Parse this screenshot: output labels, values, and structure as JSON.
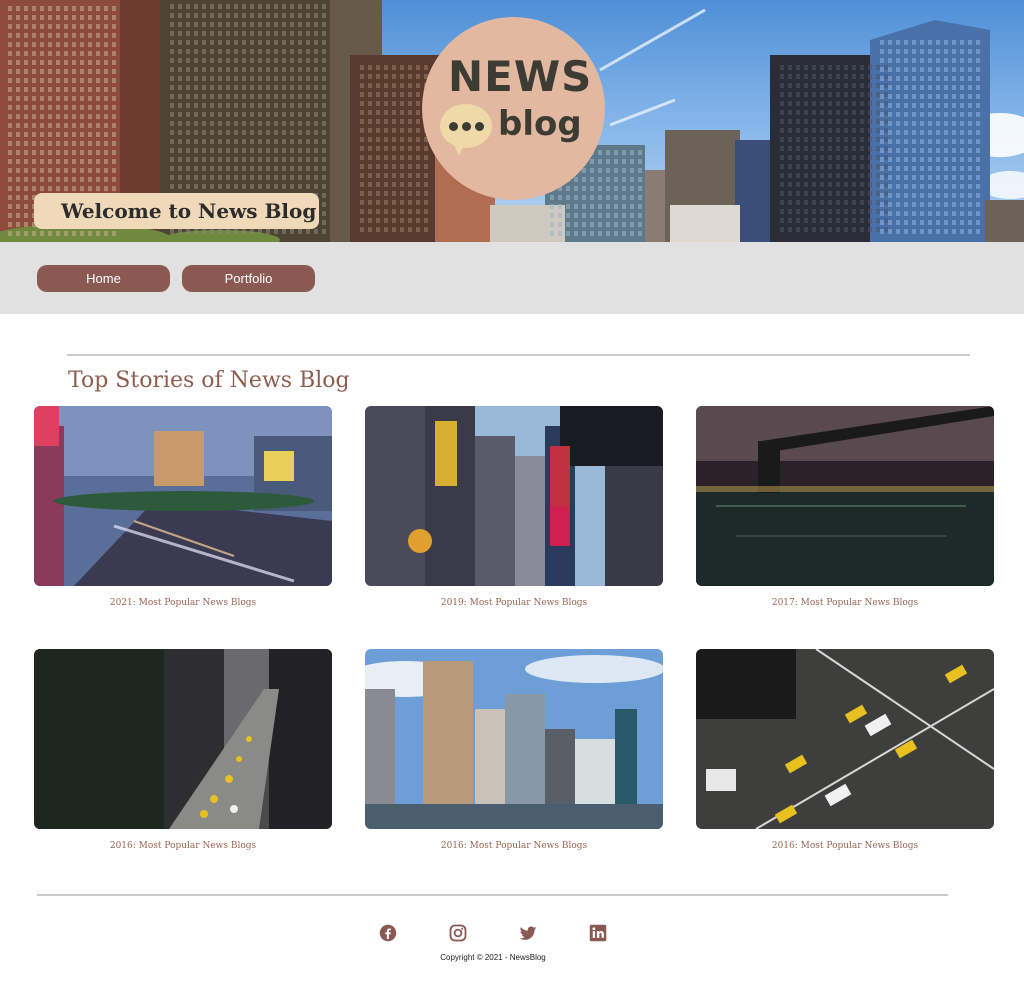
{
  "header": {
    "logo_top": "NEWS",
    "logo_bottom": "blog",
    "welcome": "Welcome to News Blog"
  },
  "nav": {
    "items": [
      {
        "label": "Home"
      },
      {
        "label": "Portfolio"
      }
    ]
  },
  "main": {
    "section_title": "Top Stories of News Blog",
    "stories": [
      {
        "caption": "2021: Most Popular News Blogs",
        "scene": "las-vegas-strip"
      },
      {
        "caption": "2019: Most Popular News Blogs",
        "scene": "times-square"
      },
      {
        "caption": "2017: Most Popular News Blogs",
        "scene": "bridge-at-night"
      },
      {
        "caption": "2016: Most Popular News Blogs",
        "scene": "avenue-traffic"
      },
      {
        "caption": "2016: Most Popular News Blogs",
        "scene": "skyline-waterfront"
      },
      {
        "caption": "2016: Most Popular News Blogs",
        "scene": "taxi-intersection"
      }
    ]
  },
  "footer": {
    "social": [
      "facebook-icon",
      "instagram-icon",
      "twitter-icon",
      "linkedin-icon"
    ],
    "copyright": "Copyright © 2021 - NewsBlog"
  },
  "colors": {
    "accent": "#8a5a52",
    "title": "#8f5d4f",
    "caption": "#9a6454",
    "nav_bg": "#e1e1e1",
    "logo_circle": "#e2b8a0",
    "welcome_bg": "#efd9b9"
  }
}
